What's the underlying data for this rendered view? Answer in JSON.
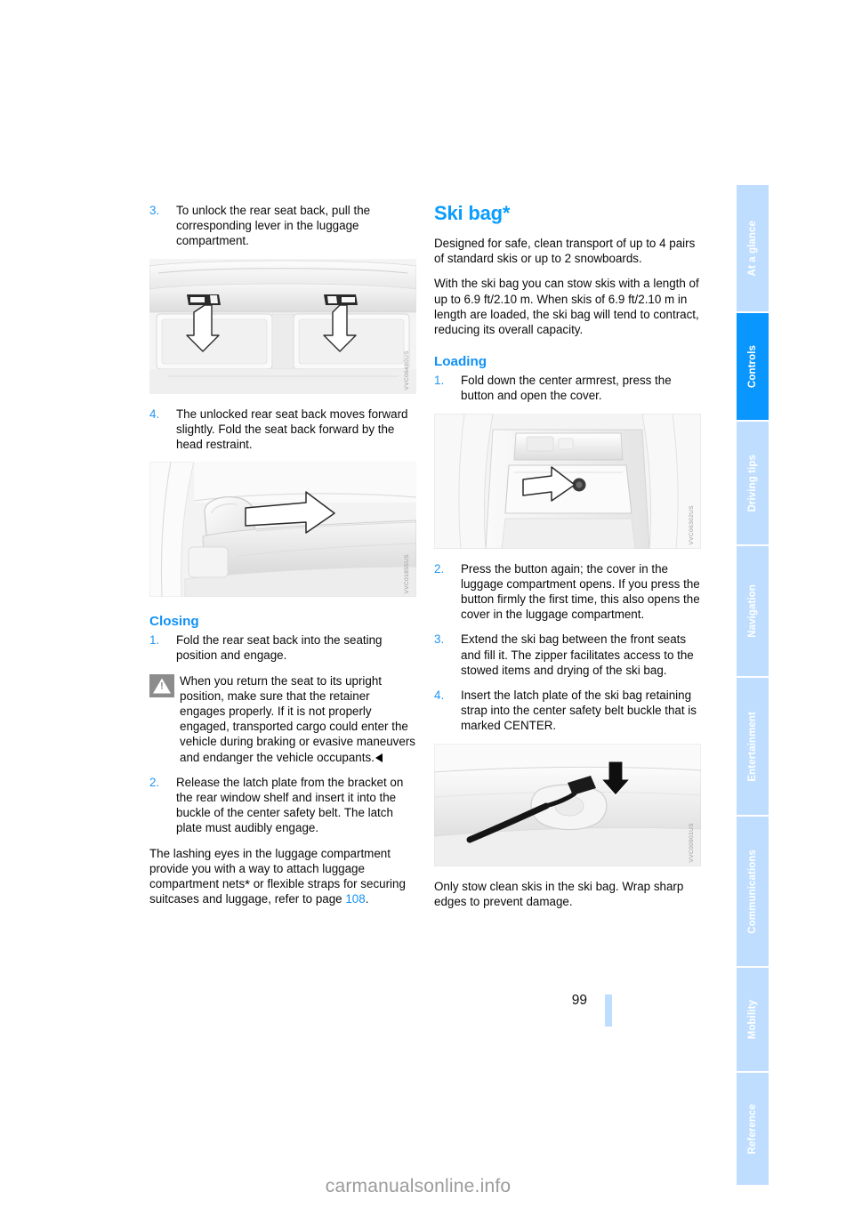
{
  "page": {
    "number": "99",
    "watermark": "carmanualsonline.info"
  },
  "left_column": {
    "step3": {
      "num": "3.",
      "text": "To unlock the rear seat back, pull the corresponding lever in the luggage compartment."
    },
    "figure1": {
      "code": "VVC06480US"
    },
    "step4": {
      "num": "4.",
      "text": "The unlocked rear seat back moves forward slightly. Fold the seat back forward by the head restraint."
    },
    "figure2": {
      "code": "VVC01855US"
    },
    "closing": {
      "heading": "Closing",
      "step1": {
        "num": "1.",
        "text": "Fold the rear seat back into the seating position and engage."
      },
      "warning": "When you return the seat to its upright position, make sure that the retainer engages properly. If it is not properly engaged, transported cargo could enter the vehicle during braking or evasive maneuvers and endanger the vehicle occupants.",
      "step2": {
        "num": "2.",
        "text": "Release the latch plate from the bracket on the rear window shelf and insert it into the buckle of the center safety belt. The latch plate must audibly engage."
      },
      "lashing_part1": "The lashing eyes in the luggage compartment provide you with a way to attach luggage compartment nets",
      "lashing_star": "*",
      "lashing_part2": " or flexible straps for securing suitcases and luggage, refer to page ",
      "lashing_pageref": "108",
      "lashing_end": "."
    }
  },
  "right_column": {
    "title": "Ski bag",
    "title_star": "*",
    "intro1": "Designed for safe, clean transport of up to 4 pairs of standard skis or up to 2 snowboards.",
    "intro2": "With the ski bag you can stow skis with a length of up to 6.9 ft/2.10 m. When skis of 6.9 ft/2.10 m in length are loaded, the ski bag will tend to contract, reducing its overall capacity.",
    "loading": {
      "heading": "Loading",
      "step1": {
        "num": "1.",
        "text": "Fold down the center armrest, press the button and open the cover."
      },
      "figure1": {
        "code": "VVC06302US"
      },
      "step2": {
        "num": "2.",
        "text": "Press the button again; the cover in the luggage compartment opens. If you press the button firmly the first time, this also opens the cover in the luggage compartment."
      },
      "step3": {
        "num": "3.",
        "text": "Extend the ski bag between the front seats and fill it. The zipper facilitates access to the stowed items and drying of the ski bag."
      },
      "step4": {
        "num": "4.",
        "text": "Insert the latch plate of the ski bag retaining strap into the center safety belt buckle that is marked CENTER."
      },
      "figure2": {
        "code": "VVC00901US"
      },
      "closing_note": "Only stow clean skis in the ski bag. Wrap sharp edges to prevent damage."
    }
  },
  "tab_rail": {
    "items": [
      {
        "label": "At a glance",
        "active": false
      },
      {
        "label": "Controls",
        "active": true
      },
      {
        "label": "Driving tips",
        "active": false
      },
      {
        "label": "Navigation",
        "active": false
      },
      {
        "label": "Entertainment",
        "active": false
      },
      {
        "label": "Communications",
        "active": false
      },
      {
        "label": "Mobility",
        "active": false
      },
      {
        "label": "Reference",
        "active": false
      }
    ]
  },
  "colors": {
    "accent_blue": "#0a9cff",
    "tab_inactive": "#bfdeff",
    "tab_active": "#0a96ff",
    "figure_bg": "#f2f2f2"
  }
}
